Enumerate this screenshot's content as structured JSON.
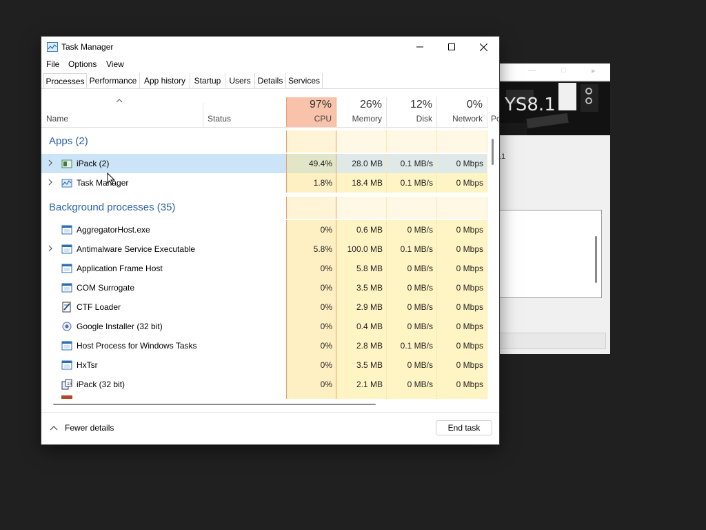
{
  "background_window": {
    "label_fragment": ".1"
  },
  "window": {
    "title": "Task Manager"
  },
  "menu": [
    "File",
    "Options",
    "View"
  ],
  "tabs": [
    {
      "label": "Processes",
      "active": true
    },
    {
      "label": "Performance"
    },
    {
      "label": "App history"
    },
    {
      "label": "Startup"
    },
    {
      "label": "Users"
    },
    {
      "label": "Details"
    },
    {
      "label": "Services"
    }
  ],
  "columns": {
    "name": "Name",
    "status": "Status",
    "cpu": {
      "percent": "97%",
      "label": "CPU"
    },
    "memory": {
      "percent": "26%",
      "label": "Memory"
    },
    "disk": {
      "percent": "12%",
      "label": "Disk"
    },
    "network": {
      "percent": "0%",
      "label": "Network"
    },
    "power_fragment": "Po"
  },
  "groups": {
    "apps": "Apps (2)",
    "background": "Background processes (35)"
  },
  "apps": [
    {
      "name": "iPack (2)",
      "icon": "app-window-icon",
      "expandable": true,
      "selected": true,
      "cpu": "49.4%",
      "memory": "28.0 MB",
      "disk": "0.1 MB/s",
      "network": "0 Mbps"
    },
    {
      "name": "Task Manager",
      "icon": "task-manager-icon",
      "expandable": true,
      "cpu": "1.8%",
      "memory": "18.4 MB",
      "disk": "0.1 MB/s",
      "network": "0 Mbps"
    }
  ],
  "background": [
    {
      "name": "AggregatorHost.exe",
      "icon": "service-window-icon",
      "cpu": "0%",
      "memory": "0.6 MB",
      "disk": "0 MB/s",
      "network": "0 Mbps"
    },
    {
      "name": "Antimalware Service Executable",
      "icon": "service-window-icon",
      "expandable": true,
      "cpu": "5.8%",
      "memory": "100.0 MB",
      "disk": "0.1 MB/s",
      "network": "0 Mbps"
    },
    {
      "name": "Application Frame Host",
      "icon": "service-window-icon",
      "cpu": "0%",
      "memory": "5.8 MB",
      "disk": "0 MB/s",
      "network": "0 Mbps"
    },
    {
      "name": "COM Surrogate",
      "icon": "service-window-icon",
      "cpu": "0%",
      "memory": "3.5 MB",
      "disk": "0 MB/s",
      "network": "0 Mbps"
    },
    {
      "name": "CTF Loader",
      "icon": "ctf-loader-icon",
      "cpu": "0%",
      "memory": "2.9 MB",
      "disk": "0 MB/s",
      "network": "0 Mbps"
    },
    {
      "name": "Google Installer (32 bit)",
      "icon": "google-installer-icon",
      "cpu": "0%",
      "memory": "0.4 MB",
      "disk": "0 MB/s",
      "network": "0 Mbps"
    },
    {
      "name": "Host Process for Windows Tasks",
      "icon": "service-window-icon",
      "cpu": "0%",
      "memory": "2.8 MB",
      "disk": "0.1 MB/s",
      "network": "0 Mbps"
    },
    {
      "name": "HxTsr",
      "icon": "service-window-icon",
      "cpu": "0%",
      "memory": "3.5 MB",
      "disk": "0 MB/s",
      "network": "0 Mbps"
    },
    {
      "name": "iPack (32 bit)",
      "icon": "ipack-icon",
      "cpu": "0%",
      "memory": "2.1 MB",
      "disk": "0 MB/s",
      "network": "0 Mbps"
    }
  ],
  "footer": {
    "fewer_details": "Fewer details",
    "end_task": "End task"
  },
  "colors": {
    "group_title": "#2b62a8",
    "cpu_header": "#f9c3ab",
    "cpu_high": "#f8e3a3",
    "cpu_low": "#fff4c4",
    "selected_row": "#cce4f7",
    "accent": "#e8a06a"
  }
}
